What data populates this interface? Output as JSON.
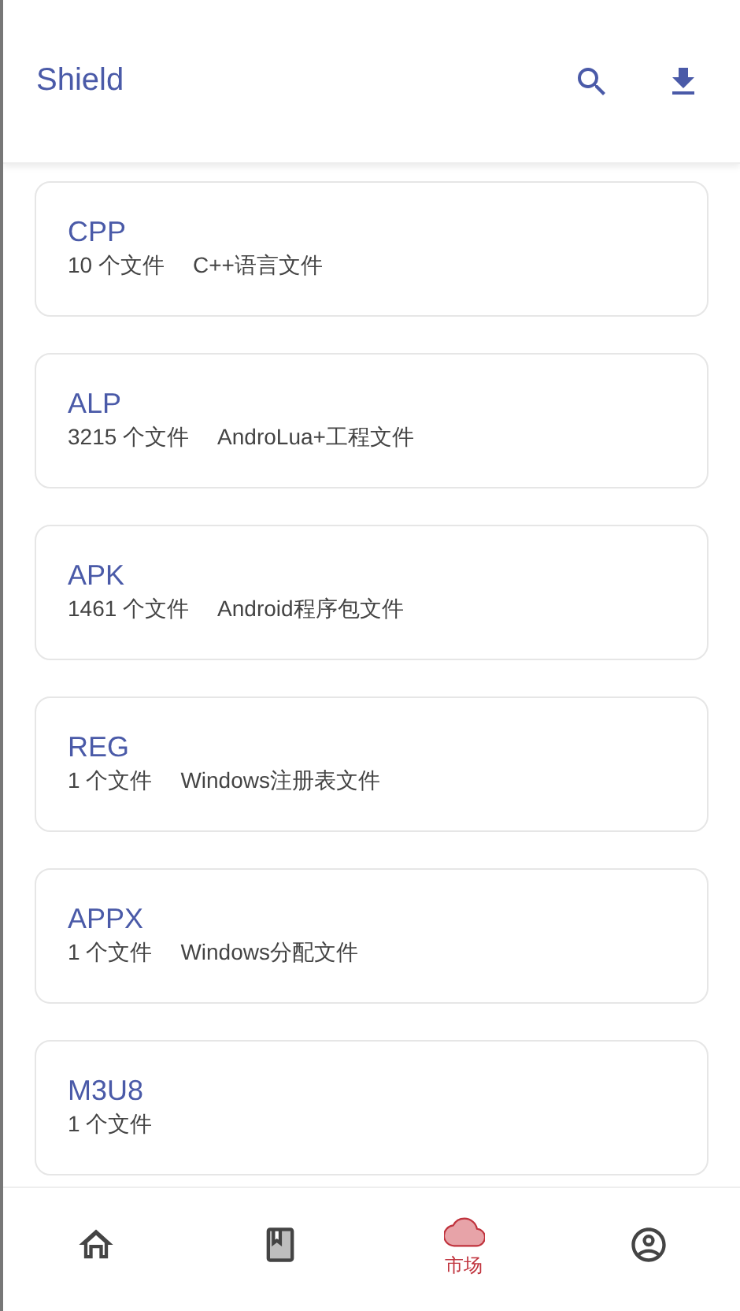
{
  "app_bar": {
    "title": "Shield"
  },
  "file_types": [
    {
      "name": "CPP",
      "count": "10 个文件",
      "description": "C++语言文件"
    },
    {
      "name": "ALP",
      "count": "3215 个文件",
      "description": "AndroLua+工程文件"
    },
    {
      "name": "APK",
      "count": "1461 个文件",
      "description": "Android程序包文件"
    },
    {
      "name": "REG",
      "count": "1 个文件",
      "description": "Windows注册表文件"
    },
    {
      "name": "APPX",
      "count": "1 个文件",
      "description": "Windows分配文件"
    },
    {
      "name": "M3U8",
      "count": "1 个文件"
    }
  ],
  "bottom_nav": [
    {
      "kind": "home",
      "selected": false
    },
    {
      "kind": "book",
      "selected": false
    },
    {
      "kind": "cloud",
      "selected": true,
      "label": "市场"
    },
    {
      "kind": "account",
      "selected": false
    }
  ]
}
